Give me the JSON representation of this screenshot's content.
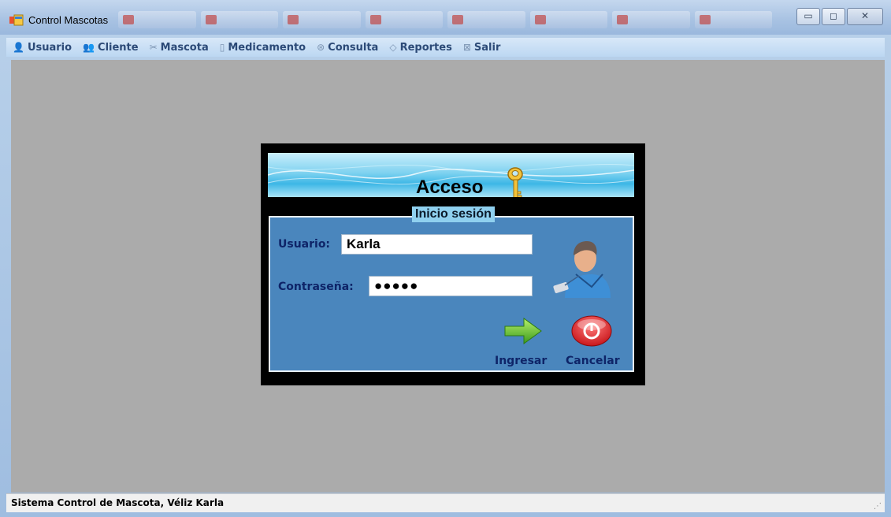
{
  "window": {
    "title": "Control Mascotas"
  },
  "menu": {
    "items": [
      {
        "label": "Usuario",
        "icon": "user-icon"
      },
      {
        "label": "Cliente",
        "icon": "people-icon"
      },
      {
        "label": "Mascota",
        "icon": "pet-icon"
      },
      {
        "label": "Medicamento",
        "icon": "medicine-icon"
      },
      {
        "label": "Consulta",
        "icon": "consult-icon"
      },
      {
        "label": "Reportes",
        "icon": "report-icon"
      },
      {
        "label": "Salir",
        "icon": "exit-icon"
      }
    ]
  },
  "dialog": {
    "banner_title": "Acceso",
    "group_title": "Inicio sesión",
    "username_label": "Usuario:",
    "username_value": "Karla",
    "password_label": "Contraseña:",
    "password_value": "●●●●●",
    "login_label": "Ingresar",
    "cancel_label": "Cancelar"
  },
  "status": {
    "text": "Sistema Control de Mascota, Véliz Karla"
  },
  "colors": {
    "client_bg": "#ababab",
    "group_bg": "#4a86bd",
    "label_color": "#0e2468",
    "menu_text": "#2c4a77"
  }
}
